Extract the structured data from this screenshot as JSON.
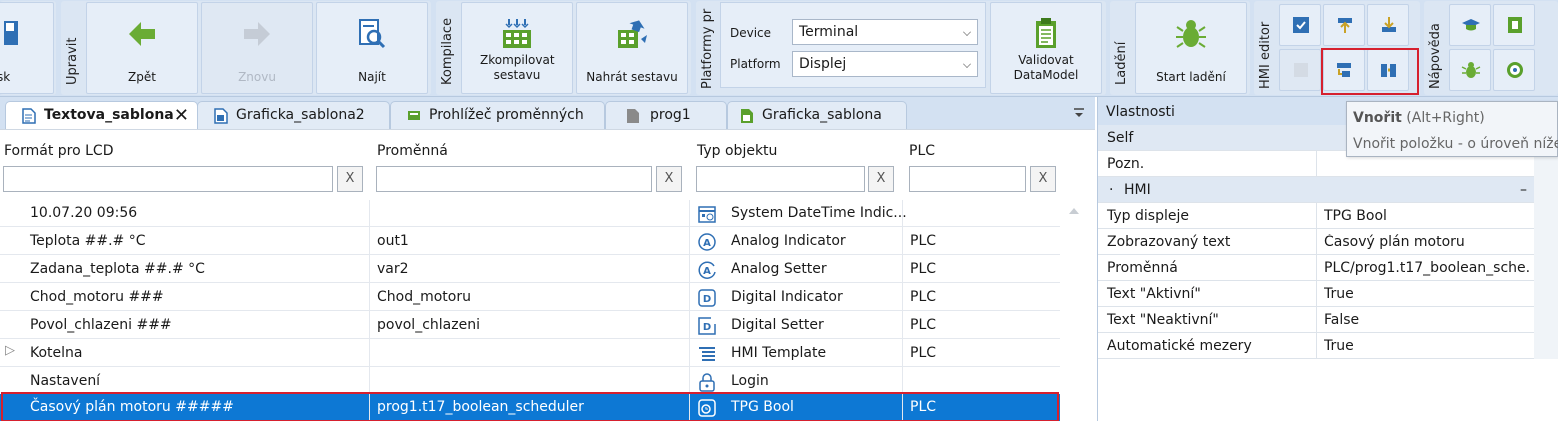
{
  "ribbon": {
    "groups": {
      "edit": "Upravit",
      "compile": "Kompilace",
      "platforms": "Platformy pr",
      "debug": "Ladění",
      "hmi_editor": "HMI editor",
      "help": "Nápověda"
    },
    "buttons": {
      "partial_left": "sk",
      "back": "Zpět",
      "redo": "Znovu",
      "find": "Najít",
      "compile": "Zkompilovat sestavu",
      "upload": "Nahrát sestavu",
      "validate": "Validovat DataModel",
      "start_debug": "Start ladění"
    },
    "device_label": "Device",
    "device_value": "Terminal",
    "platform_label": "Platform",
    "platform_value": "Displej"
  },
  "tabs": [
    {
      "label": "Textova_sablona",
      "active": true
    },
    {
      "label": "Graficka_sablona2",
      "active": false
    },
    {
      "label": "Prohlížeč proměnných",
      "active": false
    },
    {
      "label": "prog1",
      "active": false
    },
    {
      "label": "Graficka_sablona",
      "active": false
    }
  ],
  "tab_close": "✕",
  "grid": {
    "columns": [
      "Formát pro LCD",
      "Proměnná",
      "Typ objektu",
      "PLC"
    ],
    "clear_label": "X",
    "rows": [
      {
        "format": "10.07.20 09:56",
        "variable": "",
        "type": "System DateTime Indic...",
        "plc": "",
        "icon": "datetime-icon",
        "expand": ""
      },
      {
        "format": "Teplota ##.# °C",
        "variable": "out1",
        "type": "Analog Indicator",
        "plc": "PLC",
        "icon": "analog-indicator-icon",
        "expand": ""
      },
      {
        "format": "Zadana_teplota ##.# °C",
        "variable": "var2",
        "type": "Analog Setter",
        "plc": "PLC",
        "icon": "analog-setter-icon",
        "expand": ""
      },
      {
        "format": "Chod_motoru ###",
        "variable": "Chod_motoru",
        "type": "Digital Indicator",
        "plc": "PLC",
        "icon": "digital-indicator-icon",
        "expand": ""
      },
      {
        "format": "Povol_chlazeni ###",
        "variable": "povol_chlazeni",
        "type": "Digital Setter",
        "plc": "PLC",
        "icon": "digital-setter-icon",
        "expand": ""
      },
      {
        "format": "Kotelna",
        "variable": "",
        "type": "HMI Template",
        "plc": "PLC",
        "icon": "hmi-template-icon",
        "expand": "▷"
      },
      {
        "format": "Nastavení",
        "variable": "",
        "type": "Login",
        "plc": "",
        "icon": "login-lock-icon",
        "expand": ""
      },
      {
        "format": "Časový plán motoru #####",
        "variable": "prog1.t17_boolean_scheduler",
        "type": "TPG Bool",
        "plc": "PLC",
        "icon": "tpg-bool-icon",
        "expand": ""
      }
    ]
  },
  "properties": {
    "title": "Vlastnosti",
    "self_label": "Self",
    "note_label": "Pozn.",
    "section_dot": "·",
    "section_label": "HMI",
    "section_collapse": "–",
    "rows": [
      {
        "key": "Typ displeje",
        "value": "TPG Bool"
      },
      {
        "key": "Zobrazovaný text",
        "value": "Časový plán motoru"
      },
      {
        "key": "Proměnná",
        "value": "PLC/prog1.t17_boolean_sche..."
      },
      {
        "key": "Text \"Aktivní\"",
        "value": "True"
      },
      {
        "key": "Text \"Neaktivní\"",
        "value": "False"
      },
      {
        "key": "Automatické mezery",
        "value": "True"
      }
    ]
  },
  "tooltip": {
    "title": "Vnořit",
    "shortcut": "(Alt+Right)",
    "description": "Vnořit položku - o úroveň níže"
  },
  "colors": {
    "ribbon_bg": "#d3e1f2",
    "selection": "#0d78d4",
    "highlight_box": "#d6202e",
    "accent_green": "#5aa02c"
  }
}
